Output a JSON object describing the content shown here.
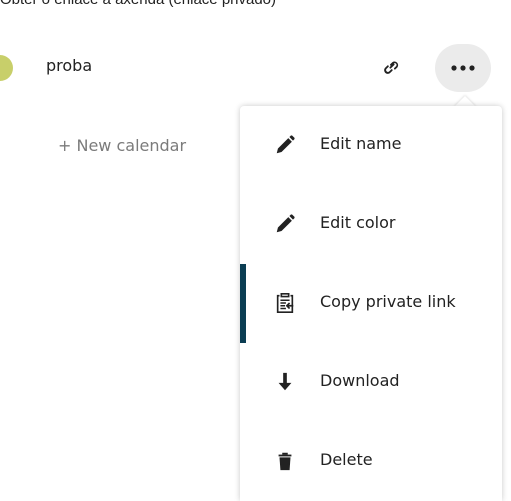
{
  "caption": "Obter o enlace á axenda (enlace privado)",
  "calendar": {
    "name": "proba",
    "color": "#c8cf6a",
    "link_icon": "link-icon",
    "more_icon": "more-horizontal-icon"
  },
  "new_calendar": "+ New calendar",
  "menu": {
    "items": [
      {
        "label": "Edit name",
        "icon": "pencil-icon"
      },
      {
        "label": "Edit color",
        "icon": "pencil-icon"
      },
      {
        "label": "Copy private link",
        "icon": "clipboard-icon",
        "active": true
      },
      {
        "label": "Download",
        "icon": "download-icon"
      },
      {
        "label": "Delete",
        "icon": "trash-icon"
      }
    ]
  },
  "colors": {
    "accent": "#0b3d53",
    "hover_bg": "#ebebeb"
  }
}
